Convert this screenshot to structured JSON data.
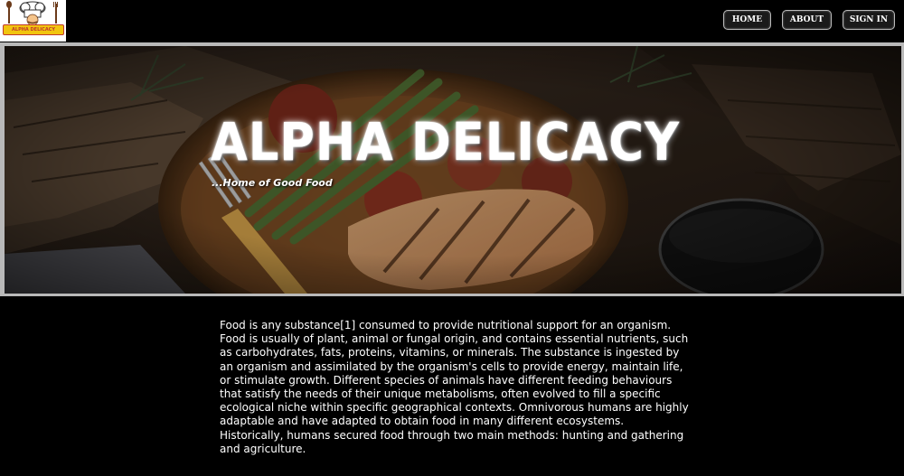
{
  "nav": {
    "home_label": "HOME",
    "about_label": "ABOUT",
    "signin_label": "SIGN IN"
  },
  "logo": {
    "text": "ALPHA DELICACY"
  },
  "hero": {
    "title": "ALPHA DELICACY",
    "tagline": "...Home of Good Food"
  },
  "content": {
    "paragraph": "Food is any substance[1] consumed to provide nutritional support for an organism. Food is usually of plant, animal or fungal origin, and contains essential nutrients, such as carbohydrates, fats, proteins, vitamins, or minerals. The substance is ingested by an organism and assimilated by the organism's cells to provide energy, maintain life, or stimulate growth. Different species of animals have different feeding behaviours that satisfy the needs of their unique metabolisms, often evolved to fill a specific ecological niche within specific geographical contexts. Omnivorous humans are highly adaptable and have adapted to obtain food in many different ecosystems. Historically, humans secured food through two main methods: hunting and gathering and agriculture."
  },
  "colors": {
    "background": "#000000",
    "text": "#ffffff",
    "button_border": "#bbbbbb",
    "logo_accent": "#c0392b"
  }
}
